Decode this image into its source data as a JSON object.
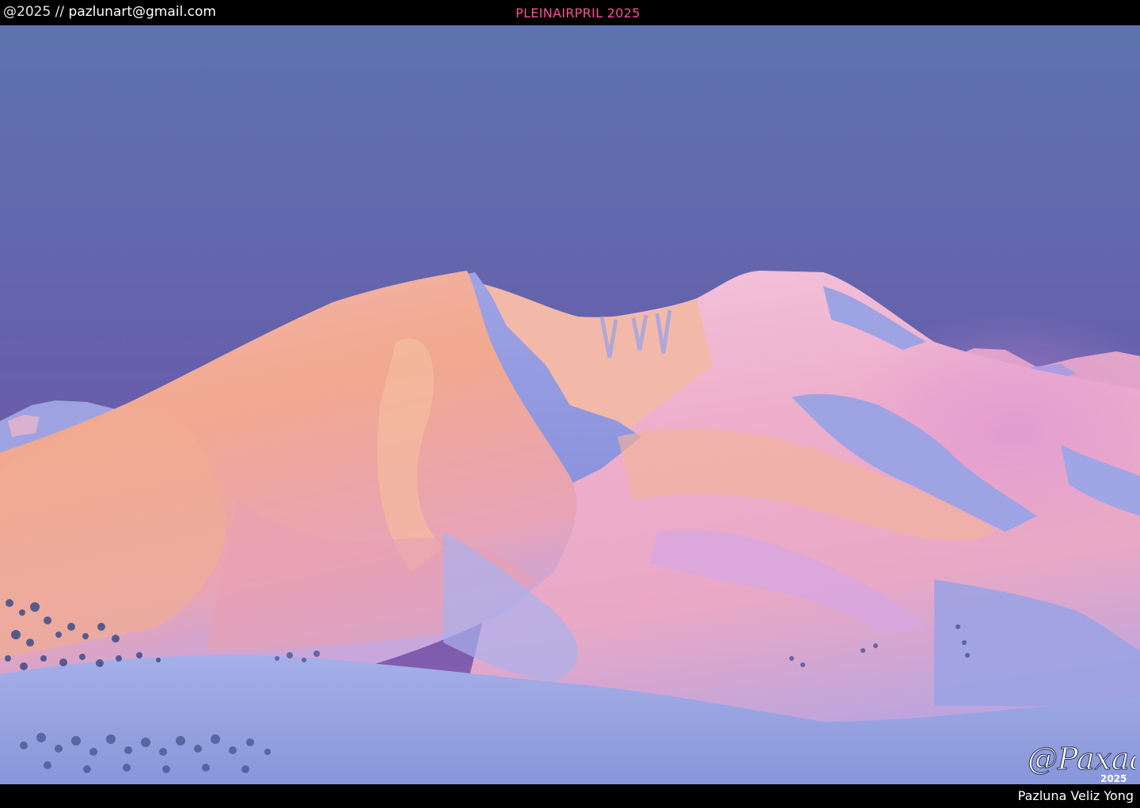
{
  "header": {
    "copyright_year": "@2025 //",
    "email": "pazlunart@gmail.com",
    "title": "PLEINAIRPRIL 2025"
  },
  "footer": {
    "artist_name": "Pazluna Veliz Yong"
  },
  "signature": {
    "name": "@Paxaa",
    "year": "2025"
  },
  "colors": {
    "frame": "#000000",
    "title": "#ff4f9a",
    "sky_top": "#5f72b0",
    "sky_bottom": "#7a55a8",
    "snow_peach": "#f0a890",
    "snow_pink": "#e8a4cf",
    "shadow_blue": "#8d93dc",
    "foreground": "#8ea0df"
  }
}
